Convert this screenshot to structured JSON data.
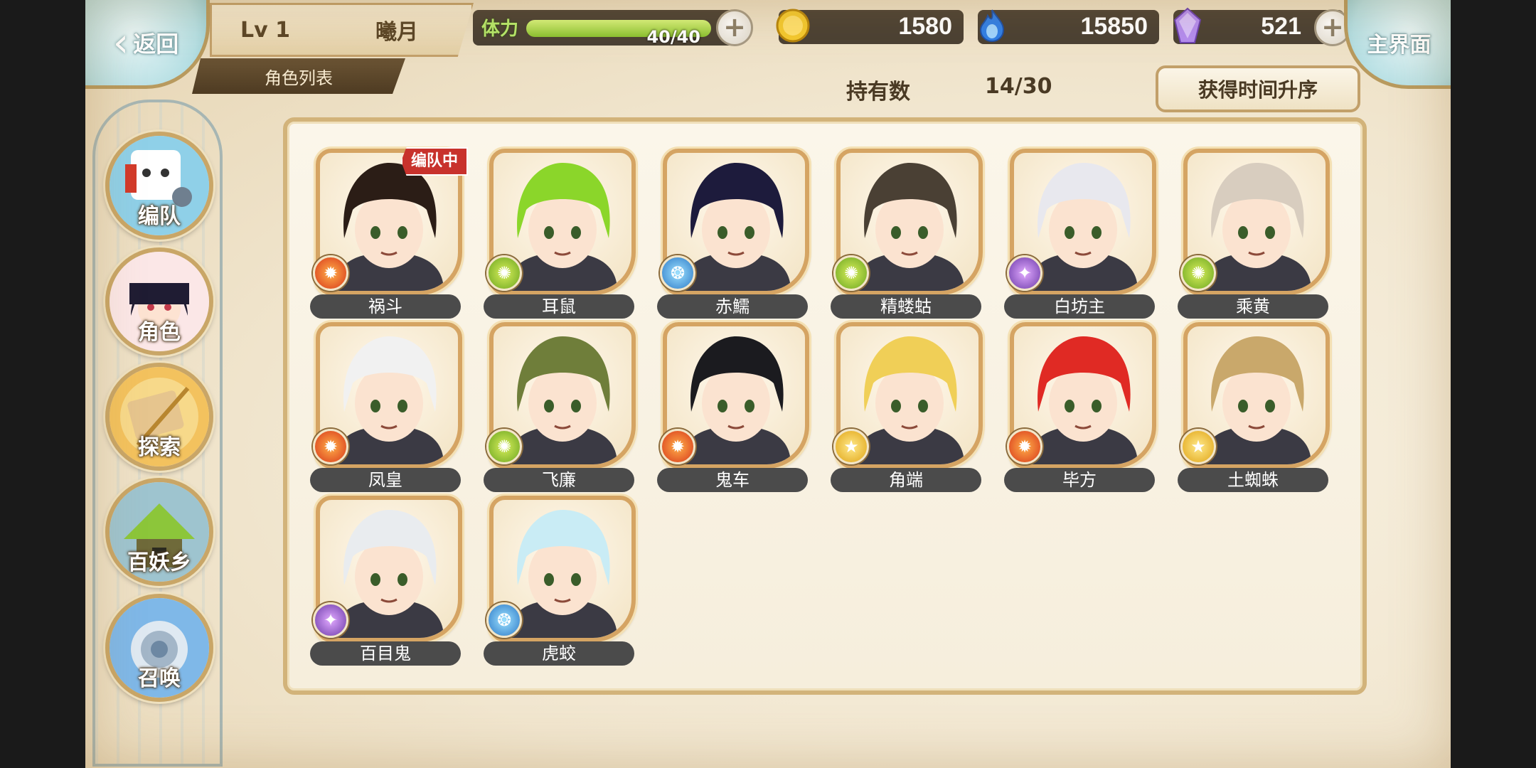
{
  "top_bar": {
    "back_label": "返回",
    "player_level": "Lv 1",
    "player_name": "曦月",
    "stamina_label": "体力",
    "stamina_value": "40/40",
    "stamina_fraction": 1.0,
    "gold": "1580",
    "soul": "15850",
    "gems": "521",
    "home_label": "主界面"
  },
  "page": {
    "tab_label": "角色列表",
    "owned_label": "持有数",
    "owned_value": "14/30",
    "sort_label": "获得时间升序",
    "team_badge": "编队中"
  },
  "nav": [
    {
      "label": "编队",
      "icon": "team-icon"
    },
    {
      "label": "角色",
      "icon": "character-icon"
    },
    {
      "label": "探索",
      "icon": "explore-icon"
    },
    {
      "label": "百妖乡",
      "icon": "village-icon"
    },
    {
      "label": "召唤",
      "icon": "summon-icon"
    }
  ],
  "characters": [
    {
      "name": "祸斗",
      "element": "fire",
      "hair": "#2b1d16",
      "in_team": true
    },
    {
      "name": "耳鼠",
      "element": "wind",
      "hair": "#8bd62a",
      "in_team": false
    },
    {
      "name": "赤鱬",
      "element": "water",
      "hair": "#1d1b3c",
      "in_team": false
    },
    {
      "name": "精蝼蛄",
      "element": "wind",
      "hair": "#4a4034",
      "in_team": false
    },
    {
      "name": "白坊主",
      "element": "dark",
      "hair": "#e8e8ee",
      "in_team": false
    },
    {
      "name": "乘黄",
      "element": "wind",
      "hair": "#d8cdbf",
      "in_team": false
    },
    {
      "name": "凤皇",
      "element": "fire",
      "hair": "#f1f1f1",
      "in_team": false
    },
    {
      "name": "飞廉",
      "element": "wind",
      "hair": "#6f7e3a",
      "in_team": false
    },
    {
      "name": "鬼车",
      "element": "fire",
      "hair": "#1b1b1f",
      "in_team": false
    },
    {
      "name": "角端",
      "element": "light",
      "hair": "#f0cf57",
      "in_team": false
    },
    {
      "name": "毕方",
      "element": "fire",
      "hair": "#e02a24",
      "in_team": false
    },
    {
      "name": "土蜘蛛",
      "element": "light",
      "hair": "#c9a86b",
      "in_team": false
    },
    {
      "name": "百目鬼",
      "element": "dark",
      "hair": "#e9ecef",
      "in_team": false
    },
    {
      "name": "虎蛟",
      "element": "water",
      "hair": "#c9ecf5",
      "in_team": false
    }
  ],
  "colors": {
    "panel_border": "#d2b37a",
    "name_plate": "#4b4b4b",
    "team_badge": "#c8322c"
  }
}
